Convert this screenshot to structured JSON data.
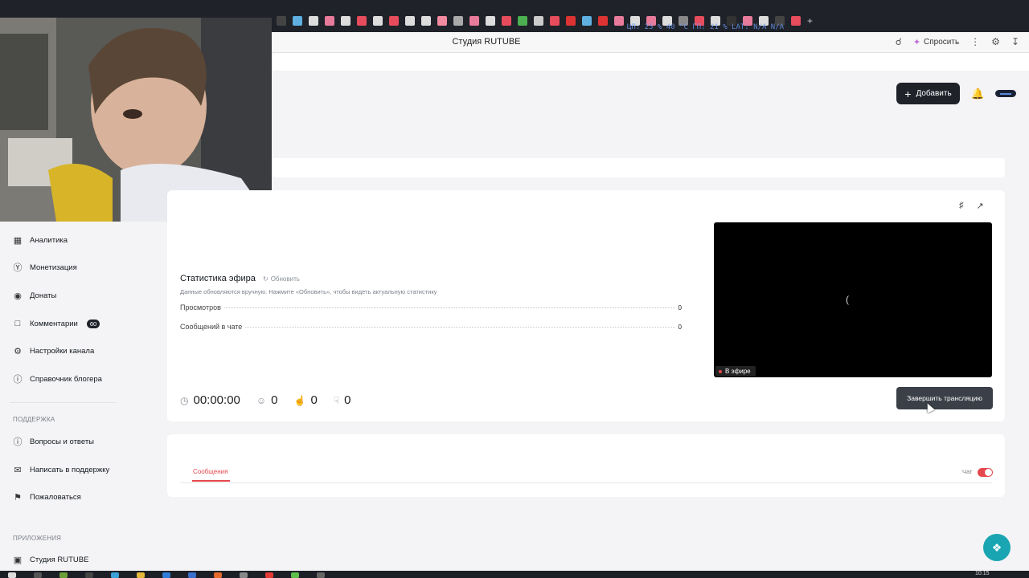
{
  "browser": {
    "page_title": "Студия RUTUBE",
    "ask_label": "Спросить",
    "overlay_text": "ЦП: 25 % 40 °C  ГП: 21 %  LAT: N/A  N/A"
  },
  "header": {
    "add_label": "Добавить"
  },
  "sidebar": {
    "items": [
      {
        "label": "Аналитика",
        "icon": "bar-chart-icon"
      },
      {
        "label": "Монетизация",
        "icon": "coin-icon"
      },
      {
        "label": "Донаты",
        "icon": "donate-icon"
      },
      {
        "label": "Комментарии",
        "icon": "comment-icon",
        "badge": "60"
      },
      {
        "label": "Настройки канала",
        "icon": "gear-icon"
      },
      {
        "label": "Справочник блогера",
        "icon": "info-icon"
      }
    ],
    "support_title": "ПОДДЕРЖКА",
    "support_items": [
      {
        "label": "Вопросы и ответы",
        "icon": "question-icon"
      },
      {
        "label": "Написать в поддержку",
        "icon": "mail-icon"
      },
      {
        "label": "Пожаловаться",
        "icon": "flag-icon"
      }
    ],
    "apps_title": "ПРИЛОЖЕНИЯ",
    "apps_items": [
      {
        "label": "Студия RUTUBE",
        "icon": "studio-icon"
      }
    ]
  },
  "stream": {
    "stats_title": "Статистика эфира",
    "refresh_label": "Обновить",
    "stats_note": "Данные обновляются вручную. Нажмите «Обновить», чтобы видеть актуальную статистику",
    "stats": [
      {
        "label": "Просмотров",
        "value": "0"
      },
      {
        "label": "Сообщений в чате",
        "value": "0"
      }
    ],
    "timer": "00:00:00",
    "viewers": "0",
    "likes": "0",
    "dislikes": "0",
    "live_badge": "В эфире",
    "end_label": "Завершить трансляцию"
  },
  "chat": {
    "tab_label": "Сообщения",
    "toggle_label": "Чат",
    "toggle_on": true
  },
  "taskbar": {
    "clock": "10:15"
  },
  "colors": {
    "accent": "#e5484d",
    "dark_button": "#1f2229",
    "help_fab": "#19a5b1"
  }
}
